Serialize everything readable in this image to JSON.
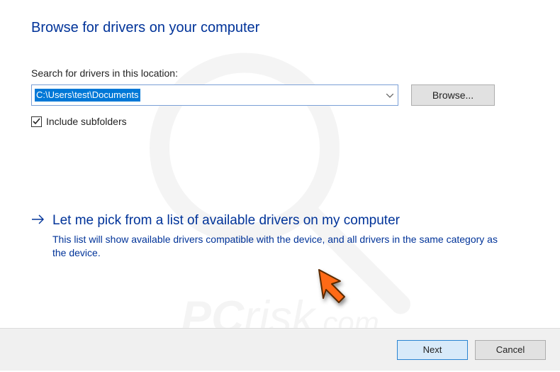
{
  "title": "Browse for drivers on your computer",
  "search": {
    "label": "Search for drivers in this location:",
    "path_value": "C:\\Users\\test\\Documents",
    "browse_label": "Browse..."
  },
  "include_subfolders": {
    "label": "Include subfolders",
    "checked": true
  },
  "pick_option": {
    "title": "Let me pick from a list of available drivers on my computer",
    "description": "This list will show available drivers compatible with the device, and all drivers in the same category as the device."
  },
  "footer": {
    "next_label": "Next",
    "cancel_label": "Cancel"
  },
  "watermark_text": "PCrisk.com",
  "annotation_arrow": {
    "color_fill": "#ff6a13",
    "color_stroke": "#5a2a00"
  }
}
